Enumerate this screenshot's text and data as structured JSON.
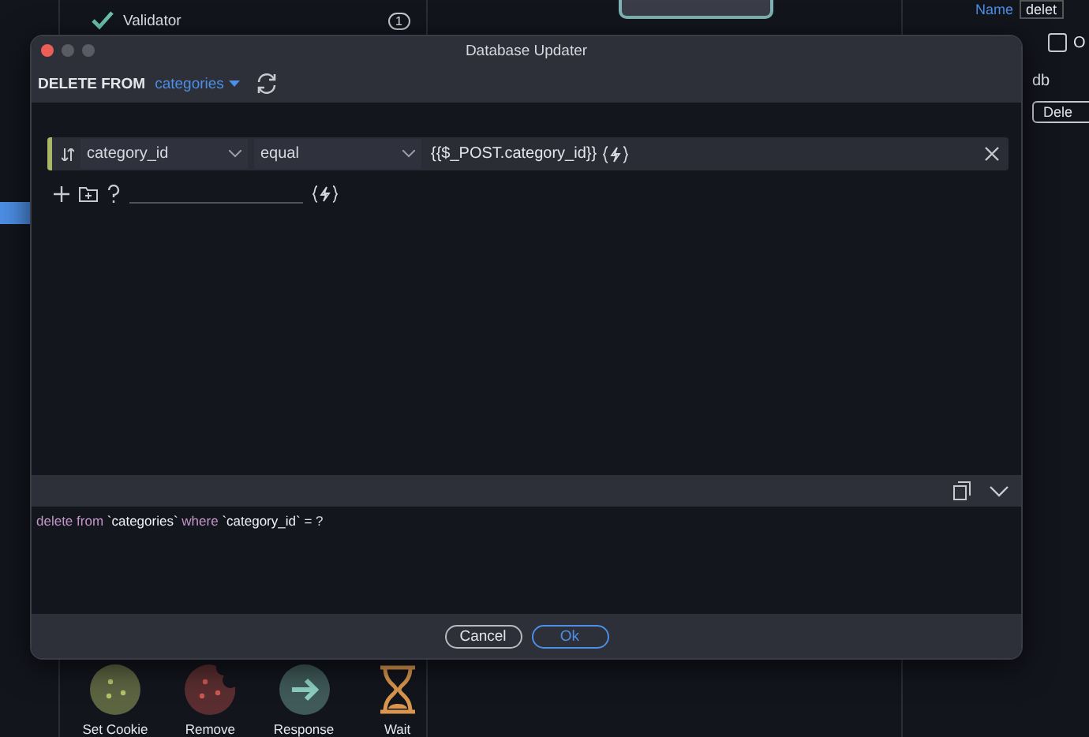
{
  "background": {
    "steps": [
      {
        "label": "Validator",
        "badge": "1",
        "done": true
      }
    ],
    "actions": [
      {
        "kind": "cookie",
        "label": "Set Cookie"
      },
      {
        "kind": "cookie-bitten",
        "label": "Remove"
      },
      {
        "kind": "arrow",
        "label": "Response"
      },
      {
        "kind": "hourglass",
        "label": "Wait"
      }
    ],
    "properties": {
      "name_label": "Name",
      "name_value": "delet",
      "checkbox": {
        "label": "O",
        "checked": false
      },
      "db_text": "db",
      "button": "Dele"
    }
  },
  "dialog": {
    "title": "Database Updater",
    "statement": "DELETE FROM",
    "table": "categories",
    "conditions": [
      {
        "column": "category_id",
        "operator": "equal",
        "value": "{{$_POST.category_id}}"
      }
    ],
    "sql": [
      {
        "kind": "keyword",
        "text": "delete from"
      },
      {
        "kind": "ident",
        "text": "`categories`"
      },
      {
        "kind": "keyword",
        "text": "where"
      },
      {
        "kind": "ident",
        "text": "`category_id`"
      },
      {
        "kind": "plain",
        "text": "= ?"
      }
    ],
    "buttons": [
      {
        "label": "Cancel",
        "primary": false
      },
      {
        "label": "Ok",
        "primary": true
      }
    ]
  }
}
